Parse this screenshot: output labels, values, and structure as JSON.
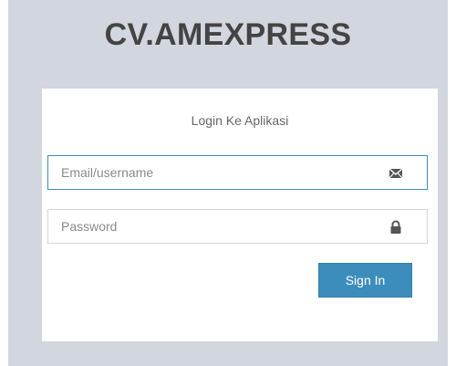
{
  "logo": {
    "text": "CV.AMEXPRESS"
  },
  "login": {
    "message": "Login Ke Aplikasi",
    "email": {
      "value": "",
      "placeholder": "Email/username",
      "icon": "envelope-icon"
    },
    "password": {
      "value": "",
      "placeholder": "Password",
      "icon": "lock-icon"
    },
    "signin_label": "Sign In"
  },
  "colors": {
    "page_background": "#d2d6de",
    "box_background": "#ffffff",
    "accent": "#3c8dbc",
    "logo_text": "#444444",
    "icon": "#555555"
  }
}
